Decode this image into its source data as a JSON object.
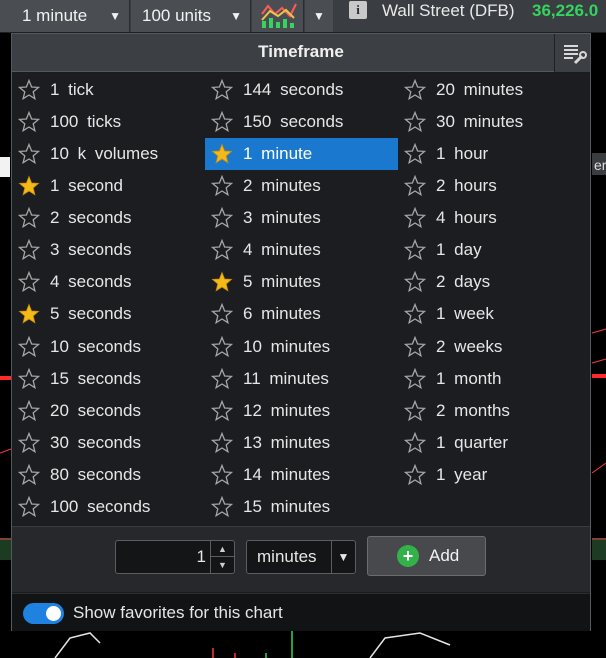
{
  "toolbar": {
    "interval": "1 minute",
    "size": "100 units",
    "chart_type_icon": "chart-line-bar-icon",
    "info_icon": "info-icon",
    "market_name": "Wall Street (DFB)",
    "market_price": "36,226.0"
  },
  "popup": {
    "title": "Timeframe",
    "columns": [
      [
        {
          "label": "1  tick",
          "fav": false
        },
        {
          "label": "100  ticks",
          "fav": false
        },
        {
          "label": "10 k  volumes",
          "fav": false
        },
        {
          "label": "1  second",
          "fav": true
        },
        {
          "label": "2  seconds",
          "fav": false
        },
        {
          "label": "3  seconds",
          "fav": false
        },
        {
          "label": "4  seconds",
          "fav": false
        },
        {
          "label": "5  seconds",
          "fav": true
        },
        {
          "label": "10  seconds",
          "fav": false
        },
        {
          "label": "15  seconds",
          "fav": false
        },
        {
          "label": "20  seconds",
          "fav": false
        },
        {
          "label": "30  seconds",
          "fav": false
        },
        {
          "label": "80  seconds",
          "fav": false
        },
        {
          "label": "100  seconds",
          "fav": false
        }
      ],
      [
        {
          "label": "144  seconds",
          "fav": false
        },
        {
          "label": "150  seconds",
          "fav": false
        },
        {
          "label": "1  minute",
          "fav": true,
          "selected": true
        },
        {
          "label": "2  minutes",
          "fav": false
        },
        {
          "label": "3  minutes",
          "fav": false
        },
        {
          "label": "4  minutes",
          "fav": false
        },
        {
          "label": "5  minutes",
          "fav": true
        },
        {
          "label": "6  minutes",
          "fav": false
        },
        {
          "label": "10  minutes",
          "fav": false
        },
        {
          "label": "11  minutes",
          "fav": false
        },
        {
          "label": "12  minutes",
          "fav": false
        },
        {
          "label": "13  minutes",
          "fav": false
        },
        {
          "label": "14  minutes",
          "fav": false
        },
        {
          "label": "15  minutes",
          "fav": false
        }
      ],
      [
        {
          "label": "20  minutes",
          "fav": false
        },
        {
          "label": "30  minutes",
          "fav": false
        },
        {
          "label": "1  hour",
          "fav": false
        },
        {
          "label": "2  hours",
          "fav": false
        },
        {
          "label": "4  hours",
          "fav": false
        },
        {
          "label": "1  day",
          "fav": false
        },
        {
          "label": "2  days",
          "fav": false
        },
        {
          "label": "1  week",
          "fav": false
        },
        {
          "label": "2  weeks",
          "fav": false
        },
        {
          "label": "1  month",
          "fav": false
        },
        {
          "label": "2  months",
          "fav": false
        },
        {
          "label": "1  quarter",
          "fav": false
        },
        {
          "label": "1  year",
          "fav": false
        }
      ]
    ],
    "custom": {
      "value": "1",
      "unit": "minutes",
      "add_label": "Add"
    },
    "favorites_toggle": {
      "label": "Show favorites for this chart",
      "on": true
    }
  },
  "colors": {
    "selected_bg": "#1a79cf",
    "star_fav": "#f5b819",
    "star_empty": "#a6a6a6",
    "price_green": "#35d35f",
    "add_green": "#33b24a",
    "toggle_blue": "#1f82e0"
  }
}
